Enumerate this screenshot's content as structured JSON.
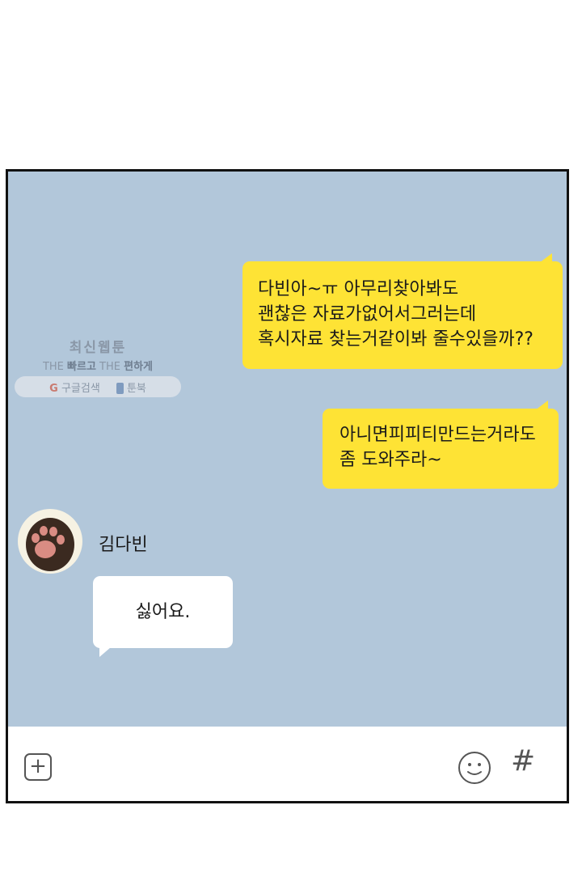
{
  "messages_outgoing": [
    {
      "lines": [
        "다빈아~ㅠ 아무리찾아봐도",
        "괜찮은 자료가없어서그러는데",
        "혹시자료 찾는거같이봐 줄수있을까??"
      ]
    },
    {
      "lines": [
        "아니면피피티만드는거라도",
        "좀 도와주라~"
      ]
    }
  ],
  "incoming": {
    "sender_name": "김다빈",
    "avatar_icon": "cat-paw-avatar",
    "message": "싫어요."
  },
  "watermark": {
    "title": "최신웹툰",
    "subtitle_parts": [
      "THE ",
      "빠르고",
      " THE ",
      "편하게"
    ],
    "search_label": "구글검색",
    "brand_label": "툰북"
  },
  "input_bar": {
    "plus_label": "+",
    "emoji_icon": "smiley-icon",
    "hash_label": "#"
  },
  "colors": {
    "chat_background": "#b2c7da",
    "outgoing_bubble": "#fee335",
    "incoming_bubble": "#ffffff"
  }
}
